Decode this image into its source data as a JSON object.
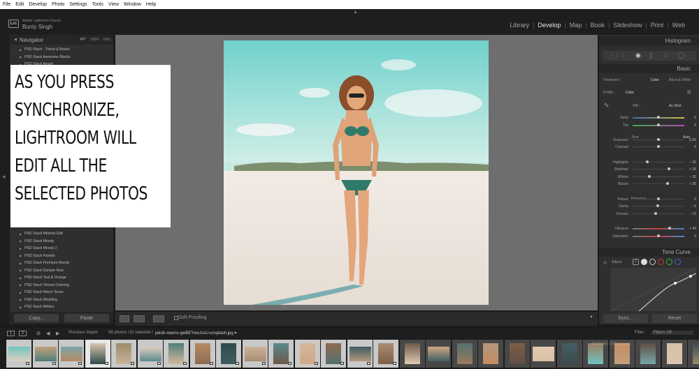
{
  "menu": [
    "File",
    "Edit",
    "Develop",
    "Photo",
    "Settings",
    "Tools",
    "View",
    "Window",
    "Help"
  ],
  "identity": {
    "logo": "Lrc",
    "app": "Adobe Lightroom Classic",
    "user": "Bunty Singh"
  },
  "modules": [
    "Library",
    "Develop",
    "Map",
    "Book",
    "Slideshow",
    "Print",
    "Web"
  ],
  "active_module": "Develop",
  "navigator": {
    "title": "Navigator",
    "zooms": [
      "FIT",
      "100%",
      "66%"
    ]
  },
  "collections_top": [
    "PSD Stack - Travel & Beach",
    "PSD Stack Awesome Blacks",
    "PSD Stack Beach"
  ],
  "collections_bottom": [
    "PSD Stack Minimal Edit",
    "PSD Stack Moody",
    "PSD Stack Moody 2",
    "PSD Stack Pastels",
    "PSD Stack Premium Moody",
    "PSD Stack Sample New",
    "PSD Stack Teal & Orange",
    "PSD Stack Vibrant Coloring",
    "PSD Stack Warm Tones",
    "PSD Stack Wedding",
    "PSD Stack Whites"
  ],
  "left_buttons": {
    "copy": "Copy...",
    "paste": "Paste"
  },
  "overlay_lines": [
    "AS YOU PRESS",
    "SYNCHRONIZE,",
    "LIGHTROOM WILL",
    "EDIT ALL THE",
    "SELECTED PHOTOS"
  ],
  "toolbar": {
    "soft_proofing": "Soft Proofing"
  },
  "right": {
    "histogram": "Histogram",
    "basic": "Basic",
    "treatment_label": "Treatment :",
    "treatment_color": "Color",
    "treatment_bw": "Black & White",
    "profile_label": "Profile :",
    "profile_value": "Color",
    "wb_label": "WB :",
    "wb_value": "As Shot",
    "tone_label": "Tone",
    "auto_label": "Auto",
    "presence_label": "Presence",
    "tone_curve": "Tone Curve",
    "adjust_label": "Adjust:",
    "sync_button": "Sync...",
    "reset_button": "Reset"
  },
  "sliders": [
    {
      "label": "Temp",
      "value": "0",
      "pos": 0.5,
      "row": 0
    },
    {
      "label": "Tint",
      "value": "0",
      "pos": 0.5,
      "row": 1
    },
    {
      "label": "Exposure",
      "value": "0.00",
      "pos": 0.5,
      "row": 3
    },
    {
      "label": "Contrast",
      "value": "0",
      "pos": 0.5,
      "row": 4
    },
    {
      "label": "Highlights",
      "value": "− 42",
      "pos": 0.29,
      "row": 6
    },
    {
      "label": "Shadows",
      "value": "+ 39",
      "pos": 0.7,
      "row": 7
    },
    {
      "label": "Whites",
      "value": "− 35",
      "pos": 0.33,
      "row": 8
    },
    {
      "label": "Blacks",
      "value": "+ 35",
      "pos": 0.68,
      "row": 9
    },
    {
      "label": "Texture",
      "value": "0",
      "pos": 0.5,
      "row": 11
    },
    {
      "label": "Clarity",
      "value": "− 5",
      "pos": 0.48,
      "row": 12
    },
    {
      "label": "Dehaze",
      "value": "− 12",
      "pos": 0.44,
      "row": 13
    },
    {
      "label": "Vibrance",
      "value": "+ 44",
      "pos": 0.72,
      "row": 15
    },
    {
      "label": "Saturation",
      "value": "0",
      "pos": 0.5,
      "row": 16
    }
  ],
  "filmstrip_bar": {
    "pages": [
      "1",
      "2"
    ],
    "source": "Previous Import",
    "count": "59 photos /15 selected /",
    "filename": "jakob-owens-gwBEYwxJxsU-unsplash.jpg ▾",
    "filter_label": "Filter :",
    "filter_value": "Filters Off"
  },
  "watermark": "Activate Windows"
}
